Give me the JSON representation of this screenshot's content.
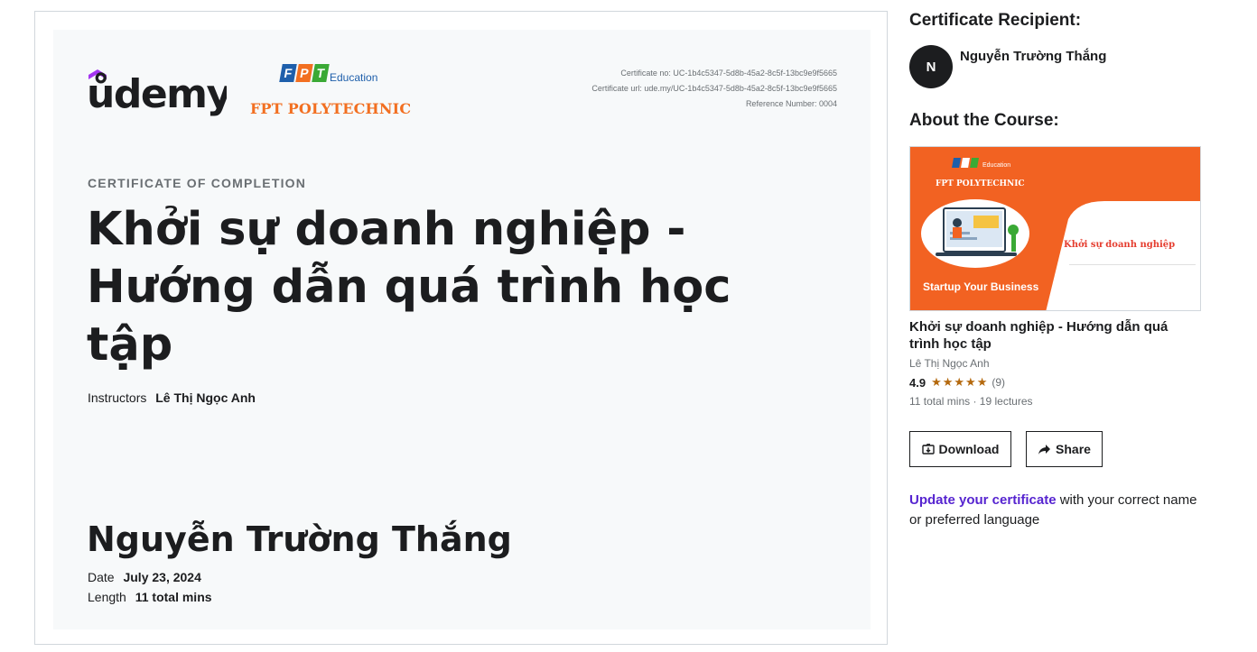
{
  "certificate": {
    "brand": "ůdemy",
    "partner_logo": {
      "letters": [
        "F",
        "P",
        "T"
      ],
      "education": "Education",
      "name": "FPT POLYTECHNIC"
    },
    "cert_no": "Certificate no: UC-1b4c5347-5d8b-45a2-8c5f-13bc9e9f5665",
    "cert_url": "Certificate url: ude.my/UC-1b4c5347-5d8b-45a2-8c5f-13bc9e9f5665",
    "reference": "Reference Number: 0004",
    "kicker": "CERTIFICATE OF COMPLETION",
    "course_title": "Khởi sự doanh nghiệp - Hướng dẫn quá trình học tập",
    "instructors_label": "Instructors",
    "instructor_name": "Lê Thị Ngọc Anh",
    "recipient_name": "Nguyễn Trường Thắng",
    "date_label": "Date",
    "date_value": "July 23, 2024",
    "length_label": "Length",
    "length_value": "11 total mins"
  },
  "sidebar": {
    "recipient_heading": "Certificate Recipient:",
    "avatar_initial": "N",
    "recipient_name": "Nguyễn Trường Thắng",
    "about_heading": "About the Course:",
    "thumbnail": {
      "brand_small": "Education",
      "brand": "FPT POLYTECHNIC",
      "course_text": "Khởi sự doanh nghiệp",
      "tagline": "Startup Your Business"
    },
    "course_title": "Khởi sự doanh nghiệp - Hướng dẫn quá trình học tập",
    "course_instructor": "Lê Thị Ngọc Anh",
    "rating": "4.9",
    "stars": "★★★★★",
    "rating_count": "(9)",
    "course_meta": "11 total mins · 19 lectures",
    "download_label": "Download",
    "share_label": "Share",
    "update_link": "Update your certificate",
    "update_rest": " with your correct name or preferred language"
  },
  "colors": {
    "accent_purple": "#5624d0",
    "fpt_orange": "#f26f21",
    "fpt_blue": "#1e5fab",
    "fpt_green": "#3aa935",
    "star_gold": "#b4690e"
  }
}
